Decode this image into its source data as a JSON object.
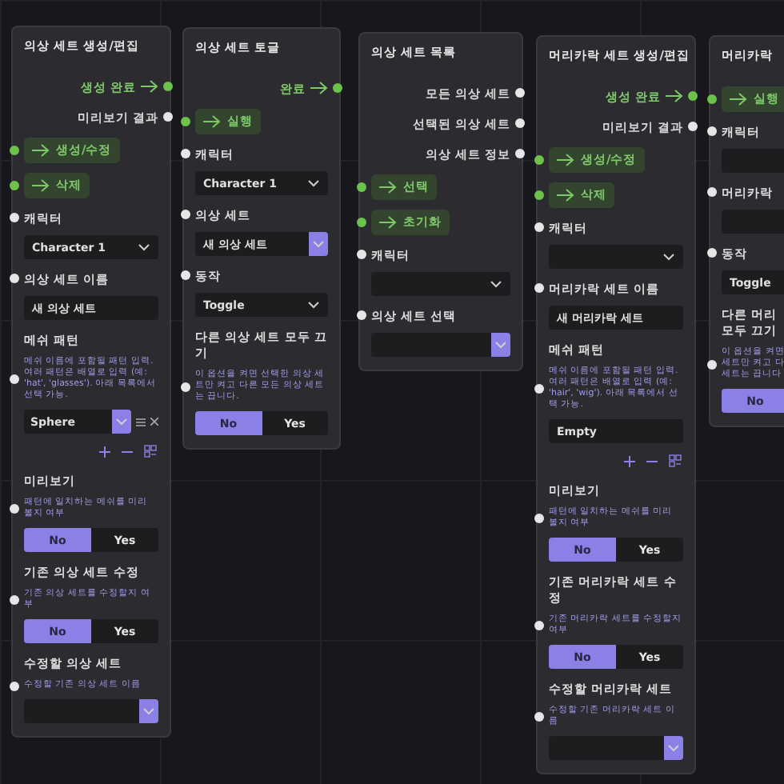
{
  "nodes": [
    {
      "title": "의상 세트 생성/편집",
      "rows": [
        {
          "kind": "output",
          "label": "생성 완료",
          "exec": true
        },
        {
          "kind": "output",
          "label": "미리보기 결과",
          "exec": false
        },
        {
          "kind": "trigger",
          "label": "생성/수정"
        },
        {
          "kind": "trigger",
          "label": "삭제"
        },
        {
          "kind": "label",
          "text": "캐릭터",
          "pin": true
        },
        {
          "kind": "select",
          "value": "Character 1",
          "accent": false
        },
        {
          "kind": "label",
          "text": "의상 세트 이름",
          "pin": true
        },
        {
          "kind": "input",
          "value": "새 의상 세트"
        },
        {
          "kind": "label",
          "text": "메쉬 패턴",
          "pin": false
        },
        {
          "kind": "desc",
          "text": "메쉬 이름에 포함될 패턴 입력. 여러 패턴은 배열로 입력 (예: 'hat', 'glasses'). 아래 목록에서 선택 가능.",
          "pin": true
        },
        {
          "kind": "pattern",
          "value": "Sphere"
        },
        {
          "kind": "tools"
        },
        {
          "kind": "label",
          "text": "미리보기",
          "pin": false
        },
        {
          "kind": "desc",
          "text": "패턴에 일치하는 메쉬를 미리 볼지 여부",
          "pin": true
        },
        {
          "kind": "toggle",
          "options": [
            {
              "label": "No",
              "selected": true
            },
            {
              "label": "Yes",
              "selected": false
            }
          ]
        },
        {
          "kind": "label",
          "text": "기존 의상 세트 수정",
          "pin": false
        },
        {
          "kind": "desc",
          "text": "기존 의상 세트를 수정할지 여부",
          "pin": true
        },
        {
          "kind": "toggle",
          "options": [
            {
              "label": "No",
              "selected": true
            },
            {
              "label": "Yes",
              "selected": false
            }
          ]
        },
        {
          "kind": "label",
          "text": "수정할 의상 세트",
          "pin": false
        },
        {
          "kind": "desc",
          "text": "수정할 기존 의상 세트 이름",
          "pin": true
        },
        {
          "kind": "select",
          "value": "",
          "accent": true
        }
      ]
    },
    {
      "title": "의상 세트 토글",
      "rows": [
        {
          "kind": "output",
          "label": "완료",
          "exec": true
        },
        {
          "kind": "trigger",
          "label": "실행"
        },
        {
          "kind": "label",
          "text": "캐릭터",
          "pin": true
        },
        {
          "kind": "select",
          "value": "Character 1",
          "accent": false
        },
        {
          "kind": "label",
          "text": "의상 세트",
          "pin": true
        },
        {
          "kind": "select",
          "value": "새 의상 세트",
          "accent": true
        },
        {
          "kind": "label",
          "text": "동작",
          "pin": true
        },
        {
          "kind": "select",
          "value": "Toggle",
          "accent": false
        },
        {
          "kind": "label",
          "text": "다른 의상 세트 모두 끄기",
          "pin": false
        },
        {
          "kind": "desc",
          "text": "이 옵션을 켜면 선택한 의상 세트만 켜고 다른 모든 의상 세트는 끕니다.",
          "pin": true
        },
        {
          "kind": "toggle",
          "options": [
            {
              "label": "No",
              "selected": true
            },
            {
              "label": "Yes",
              "selected": false
            }
          ]
        }
      ]
    },
    {
      "title": "의상 세트 목록",
      "rows": [
        {
          "kind": "output",
          "label": "모든 의상 세트",
          "exec": false
        },
        {
          "kind": "output",
          "label": "선택된 의상 세트",
          "exec": false
        },
        {
          "kind": "output",
          "label": "의상 세트 정보",
          "exec": false
        },
        {
          "kind": "trigger",
          "label": "선택"
        },
        {
          "kind": "trigger",
          "label": "초기화"
        },
        {
          "kind": "label",
          "text": "캐릭터",
          "pin": true
        },
        {
          "kind": "select",
          "value": "",
          "accent": false
        },
        {
          "kind": "label",
          "text": "의상 세트 선택",
          "pin": true
        },
        {
          "kind": "select",
          "value": "",
          "accent": true
        }
      ]
    },
    {
      "title": "머리카락 세트 생성/편집",
      "rows": [
        {
          "kind": "output",
          "label": "생성 완료",
          "exec": true
        },
        {
          "kind": "output",
          "label": "미리보기 결과",
          "exec": false
        },
        {
          "kind": "trigger",
          "label": "생성/수정"
        },
        {
          "kind": "trigger",
          "label": "삭제"
        },
        {
          "kind": "label",
          "text": "캐릭터",
          "pin": true
        },
        {
          "kind": "select",
          "value": "",
          "accent": false
        },
        {
          "kind": "label",
          "text": "머리카락 세트 이름",
          "pin": true
        },
        {
          "kind": "input",
          "value": "새 머리카락 세트"
        },
        {
          "kind": "label",
          "text": "메쉬 패턴",
          "pin": false
        },
        {
          "kind": "desc",
          "text": "메쉬 이름에 포함될 패턴 입력. 여러 패턴은 배열로 입력 (예: 'hair', 'wig'). 아래 목록에서 선택 가능.",
          "pin": true
        },
        {
          "kind": "input",
          "value": "Empty"
        },
        {
          "kind": "tools"
        },
        {
          "kind": "label",
          "text": "미리보기",
          "pin": false
        },
        {
          "kind": "desc",
          "text": "패턴에 일치하는 메쉬를 미리 볼지 여부",
          "pin": true
        },
        {
          "kind": "toggle",
          "options": [
            {
              "label": "No",
              "selected": true
            },
            {
              "label": "Yes",
              "selected": false
            }
          ]
        },
        {
          "kind": "label",
          "text": "기존 머리카락 세트 수정",
          "pin": false
        },
        {
          "kind": "desc",
          "text": "기존 머리카락 세트를 수정할지 여부",
          "pin": true
        },
        {
          "kind": "toggle",
          "options": [
            {
              "label": "No",
              "selected": true
            },
            {
              "label": "Yes",
              "selected": false
            }
          ]
        },
        {
          "kind": "label",
          "text": "수정할 머리카락 세트",
          "pin": false
        },
        {
          "kind": "desc",
          "text": "수정할 기존 머리카락 세트 이름",
          "pin": true
        },
        {
          "kind": "select",
          "value": "",
          "accent": true
        }
      ]
    },
    {
      "title": "머리카락",
      "rows": [
        {
          "kind": "trigger",
          "label": "실행"
        },
        {
          "kind": "label",
          "text": "캐릭터",
          "pin": true
        },
        {
          "kind": "select",
          "value": "",
          "accent": false
        },
        {
          "kind": "label",
          "text": "머리카락",
          "pin": true
        },
        {
          "kind": "select",
          "value": "",
          "accent": false
        },
        {
          "kind": "label",
          "text": "동작",
          "pin": true
        },
        {
          "kind": "select",
          "value": "Toggle",
          "accent": false
        },
        {
          "kind": "label",
          "text": "다른 머리\n모두 끄기",
          "pin": false
        },
        {
          "kind": "desc",
          "text": "이 옵션을 켜면\n세트만 켜고 다\n세트는 끕니다",
          "pin": true
        },
        {
          "kind": "toggle",
          "options": [
            {
              "label": "No",
              "selected": true
            }
          ]
        }
      ]
    }
  ]
}
